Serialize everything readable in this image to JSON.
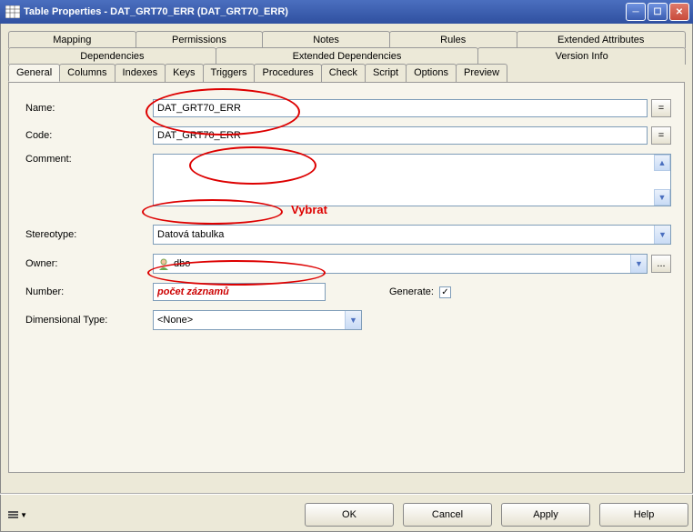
{
  "titlebar": {
    "title": "Table Properties - DAT_GRT70_ERR (DAT_GRT70_ERR)"
  },
  "tabs": {
    "row1": [
      "Mapping",
      "Permissions",
      "Notes",
      "Rules",
      "Extended Attributes"
    ],
    "row2": [
      "Dependencies",
      "Extended Dependencies",
      "Version Info"
    ],
    "row3": [
      "General",
      "Columns",
      "Indexes",
      "Keys",
      "Triggers",
      "Procedures",
      "Check",
      "Script",
      "Options",
      "Preview"
    ],
    "active": "General"
  },
  "general": {
    "name_label": "Name:",
    "name_value": "DAT_GRT70_ERR",
    "name_eq": "=",
    "code_label": "Code:",
    "code_value": "DAT_GRT70_ERR",
    "code_eq": "=",
    "comment_label": "Comment:",
    "comment_value": "",
    "stereotype_label": "Stereotype:",
    "stereotype_value": "Datová tabulka",
    "owner_label": "Owner:",
    "owner_value": "dbo",
    "owner_more": "...",
    "number_label": "Number:",
    "number_value": "počet záznamů",
    "generate_label": "Generate:",
    "generate_checked": "✓",
    "dim_label": "Dimensional Type:",
    "dim_value": "<None>"
  },
  "footer": {
    "ok": "OK",
    "cancel": "Cancel",
    "apply": "Apply",
    "help": "Help"
  },
  "annotations": {
    "vybrat": "Vybrat"
  }
}
